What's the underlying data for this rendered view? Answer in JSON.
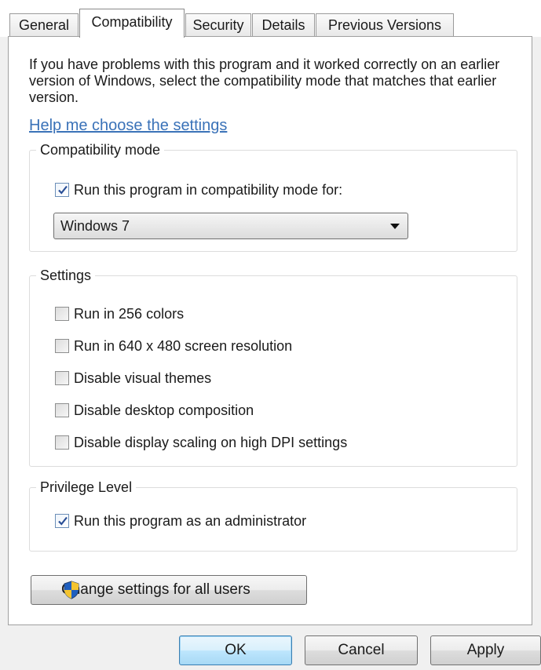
{
  "tabs": [
    {
      "label": "General",
      "active": false
    },
    {
      "label": "Compatibility",
      "active": true
    },
    {
      "label": "Security",
      "active": false
    },
    {
      "label": "Details",
      "active": false
    },
    {
      "label": "Previous Versions",
      "active": false
    }
  ],
  "intro_text": "If you have problems with this program and it worked correctly on an earlier version of Windows, select the compatibility mode that matches that earlier version.",
  "help_link": "Help me choose the settings",
  "compat_group": {
    "title": "Compatibility mode",
    "checkbox_label": "Run this program in compatibility mode for:",
    "checked": true,
    "selected_os": "Windows 7"
  },
  "settings_group": {
    "title": "Settings",
    "items": [
      {
        "label": "Run in 256 colors",
        "checked": false
      },
      {
        "label": "Run in 640 x 480 screen resolution",
        "checked": false
      },
      {
        "label": "Disable visual themes",
        "checked": false
      },
      {
        "label": "Disable desktop composition",
        "checked": false
      },
      {
        "label": "Disable display scaling on high DPI settings",
        "checked": false
      }
    ]
  },
  "privilege_group": {
    "title": "Privilege Level",
    "checkbox_label": "Run this program as an administrator",
    "checked": true
  },
  "change_all_users_button": "Change settings for all users",
  "footer": {
    "ok": "OK",
    "cancel": "Cancel",
    "apply": "Apply"
  },
  "icons": {
    "uac": "uac-shield-icon",
    "check": "checkmark-icon",
    "dropdown": "chevron-down-icon"
  }
}
